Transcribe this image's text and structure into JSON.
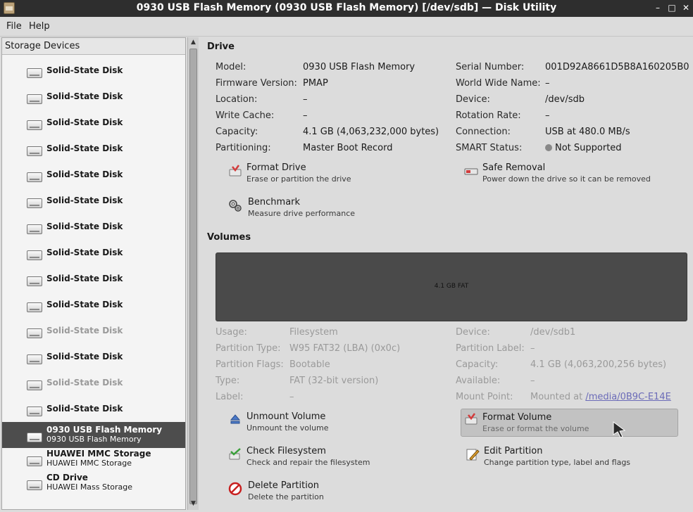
{
  "window": {
    "title": "0930 USB Flash Memory (0930 USB Flash Memory) [/dev/sdb] — Disk Utility",
    "btn_min": "–",
    "btn_max": "□",
    "btn_close": "✕"
  },
  "menu": {
    "file": "File",
    "help": "Help"
  },
  "sidebar": {
    "header": "Storage Devices",
    "devices": [
      {
        "name": "Solid-State Disk",
        "sub": "",
        "dim": false
      },
      {
        "name": "Solid-State Disk",
        "sub": "",
        "dim": false
      },
      {
        "name": "Solid-State Disk",
        "sub": "",
        "dim": false
      },
      {
        "name": "Solid-State Disk",
        "sub": "",
        "dim": false
      },
      {
        "name": "Solid-State Disk",
        "sub": "",
        "dim": false
      },
      {
        "name": "Solid-State Disk",
        "sub": "",
        "dim": false
      },
      {
        "name": "Solid-State Disk",
        "sub": "",
        "dim": false
      },
      {
        "name": "Solid-State Disk",
        "sub": "",
        "dim": false
      },
      {
        "name": "Solid-State Disk",
        "sub": "",
        "dim": false
      },
      {
        "name": "Solid-State Disk",
        "sub": "",
        "dim": false
      },
      {
        "name": "Solid-State Disk",
        "sub": "",
        "dim": false
      },
      {
        "name": "Solid-State Disk",
        "sub": "",
        "dim": true
      },
      {
        "name": "Solid-State Disk",
        "sub": "",
        "dim": false
      },
      {
        "name": "Solid-State Disk",
        "sub": "",
        "dim": true
      },
      {
        "name": "Solid-State Disk",
        "sub": "",
        "dim": false
      },
      {
        "name": "0930 USB Flash Memory",
        "sub": "0930 USB Flash Memory",
        "dim": false,
        "selected": true
      },
      {
        "name": "HUAWEI MMC Storage",
        "sub": "HUAWEI MMC Storage",
        "dim": false
      },
      {
        "name": "CD Drive",
        "sub": "HUAWEI Mass Storage",
        "dim": false
      }
    ]
  },
  "drive": {
    "heading": "Drive",
    "left": [
      {
        "label": "Model:",
        "value": "0930 USB Flash Memory"
      },
      {
        "label": "Firmware Version:",
        "value": "PMAP"
      },
      {
        "label": "Location:",
        "value": "–"
      },
      {
        "label": "Write Cache:",
        "value": "–"
      },
      {
        "label": "Capacity:",
        "value": "4.1 GB (4,063,232,000 bytes)"
      },
      {
        "label": "Partitioning:",
        "value": "Master Boot Record"
      }
    ],
    "right": [
      {
        "label": "Serial Number:",
        "value": "001D92A8661D5B8A160205B0"
      },
      {
        "label": "World Wide Name:",
        "value": "–"
      },
      {
        "label": "Device:",
        "value": "/dev/sdb"
      },
      {
        "label": "Rotation Rate:",
        "value": "–"
      },
      {
        "label": "Connection:",
        "value": "USB at 480.0 MB/s"
      },
      {
        "label": "SMART Status:",
        "value": "Not Supported"
      }
    ],
    "actions": {
      "format": {
        "title": "Format Drive",
        "desc": "Erase or partition the drive"
      },
      "safe_removal": {
        "title": "Safe Removal",
        "desc": "Power down the drive so it can be removed"
      },
      "benchmark": {
        "title": "Benchmark",
        "desc": "Measure drive performance"
      }
    }
  },
  "volumes": {
    "heading": "Volumes",
    "bar_label": "4.1 GB FAT",
    "left": [
      {
        "label": "Usage:",
        "value": "Filesystem"
      },
      {
        "label": "Partition Type:",
        "value": "W95 FAT32 (LBA) (0x0c)"
      },
      {
        "label": "Partition Flags:",
        "value": "Bootable"
      },
      {
        "label": "Type:",
        "value": "FAT (32-bit version)"
      },
      {
        "label": "Label:",
        "value": "–"
      }
    ],
    "right": [
      {
        "label": "Device:",
        "value": "/dev/sdb1"
      },
      {
        "label": "Partition Label:",
        "value": "–"
      },
      {
        "label": "Capacity:",
        "value": "4.1 GB (4,063,200,256 bytes)"
      },
      {
        "label": "Available:",
        "value": "–"
      },
      {
        "label": "Mount Point:",
        "value": "Mounted at",
        "link": "/media/0B9C-E14E"
      }
    ],
    "actions": {
      "unmount": {
        "title": "Unmount Volume",
        "desc": "Unmount the volume"
      },
      "format": {
        "title": "Format Volume",
        "desc": "Erase or format the volume"
      },
      "check": {
        "title": "Check Filesystem",
        "desc": "Check and repair the filesystem"
      },
      "edit": {
        "title": "Edit Partition",
        "desc": "Change partition type, label and flags"
      },
      "delete": {
        "title": "Delete Partition",
        "desc": "Delete the partition"
      }
    }
  }
}
